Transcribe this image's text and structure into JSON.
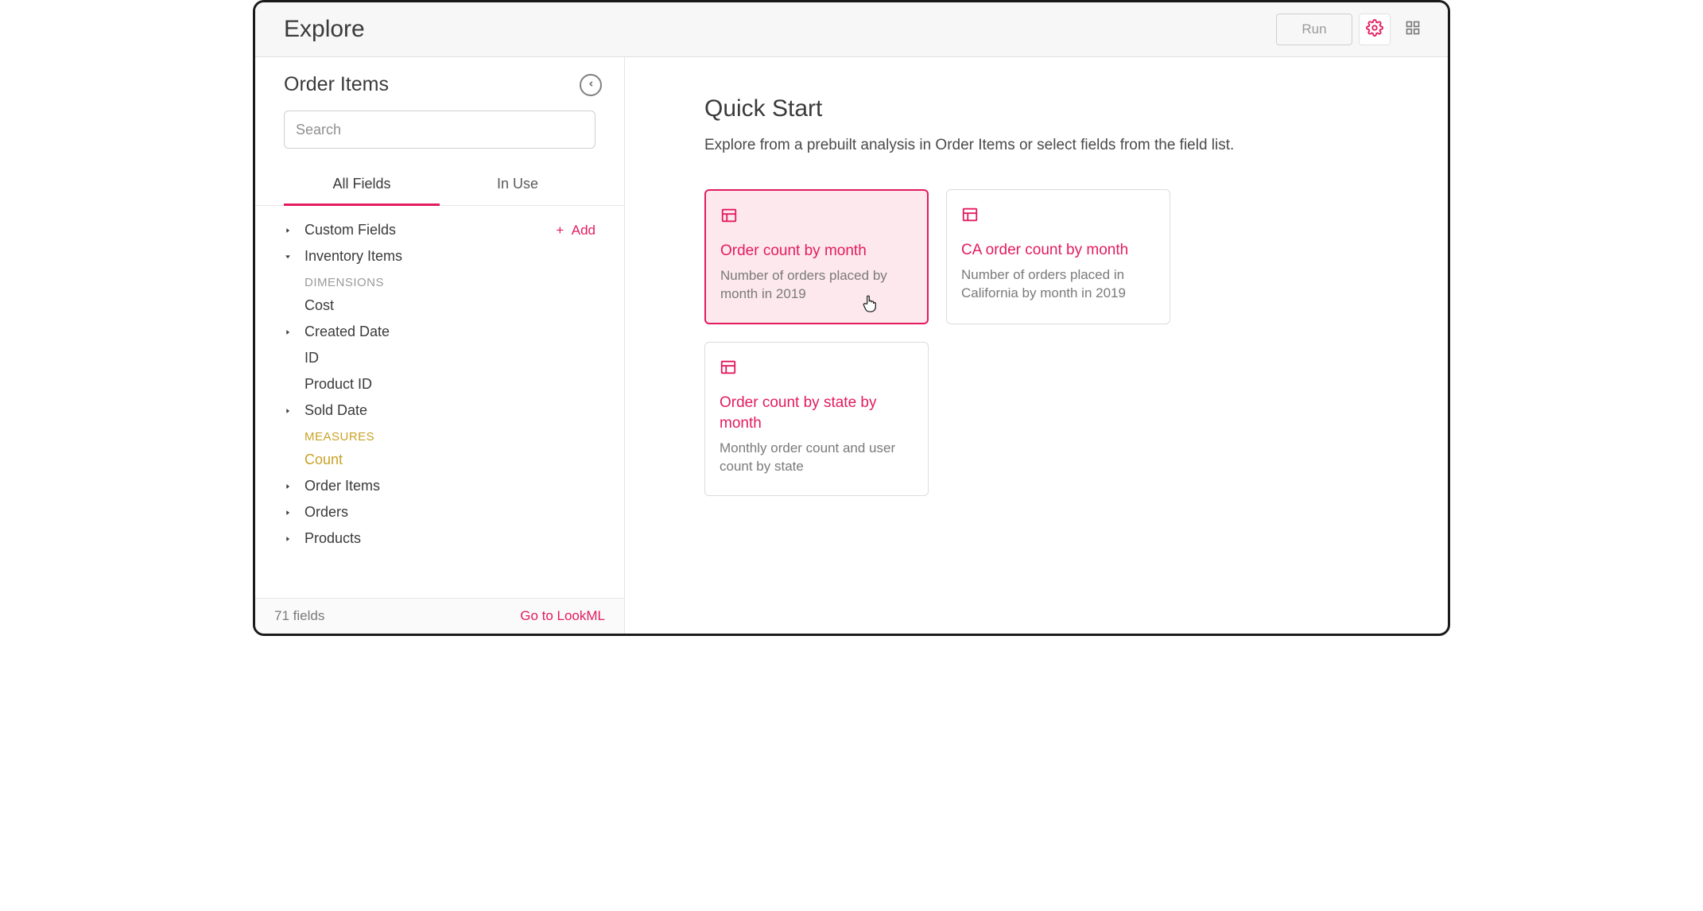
{
  "header": {
    "title": "Explore",
    "run_label": "Run"
  },
  "sidebar": {
    "title": "Order Items",
    "search_placeholder": "Search",
    "tabs": {
      "all_fields": "All Fields",
      "in_use": "In Use"
    },
    "add_label": "Add",
    "groups": {
      "custom_fields": "Custom Fields",
      "inventory_items": "Inventory Items",
      "order_items": "Order Items",
      "orders": "Orders",
      "products": "Products"
    },
    "dimensions_label": "DIMENSIONS",
    "measures_label": "MEASURES",
    "fields": {
      "cost": "Cost",
      "created_date": "Created Date",
      "id": "ID",
      "product_id": "Product ID",
      "sold_date": "Sold Date",
      "count": "Count"
    },
    "footer": {
      "count": "71 fields",
      "lookml": "Go to LookML"
    }
  },
  "main": {
    "heading": "Quick Start",
    "subtitle": "Explore from a prebuilt analysis in Order Items or select fields from the field list.",
    "cards": [
      {
        "title": "Order count by month",
        "desc": "Number of orders placed by month in 2019"
      },
      {
        "title": "CA order count by month",
        "desc": "Number of orders placed in California by month in 2019"
      },
      {
        "title": "Order count by state by month",
        "desc": "Monthly order count and user count by state"
      }
    ]
  }
}
